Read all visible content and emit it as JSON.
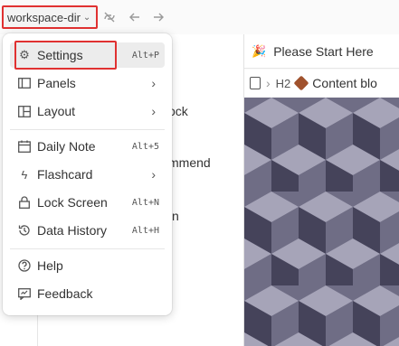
{
  "topbar": {
    "workspace_label": "workspace-dir",
    "workspace_chevron": "chevron-down-icon",
    "icons": [
      "sync-off-icon",
      "back-arrow-icon",
      "forward-arrow-icon"
    ]
  },
  "background": {
    "left_fragments": [
      "ock",
      "mmend",
      "n"
    ]
  },
  "tab": {
    "title": "Please Start Here",
    "icon": "party-popper-icon"
  },
  "breadcrumb": {
    "heading_level": "H2",
    "item": "Content blo"
  },
  "menu": {
    "items": [
      {
        "label": "Settings",
        "shortcut": "Alt+P",
        "icon": "gear-icon"
      },
      {
        "label": "Panels",
        "icon": "panels-icon",
        "submenu": true
      },
      {
        "label": "Layout",
        "icon": "layout-icon",
        "submenu": true
      },
      {
        "label": "Daily Note",
        "shortcut": "Alt+5",
        "icon": "calendar-icon"
      },
      {
        "label": "Flashcard",
        "icon": "flash-icon",
        "submenu": true
      },
      {
        "label": "Lock Screen",
        "shortcut": "Alt+N",
        "icon": "lock-icon"
      },
      {
        "label": "Data History",
        "shortcut": "Alt+H",
        "icon": "history-icon"
      },
      {
        "label": "Help",
        "icon": "help-icon"
      },
      {
        "label": "Feedback",
        "icon": "feedback-icon"
      }
    ]
  },
  "colors": {
    "highlight": "#e03131",
    "cube_light": "#a6a4b8",
    "cube_mid": "#6f6d85",
    "cube_dark": "#45435a"
  }
}
